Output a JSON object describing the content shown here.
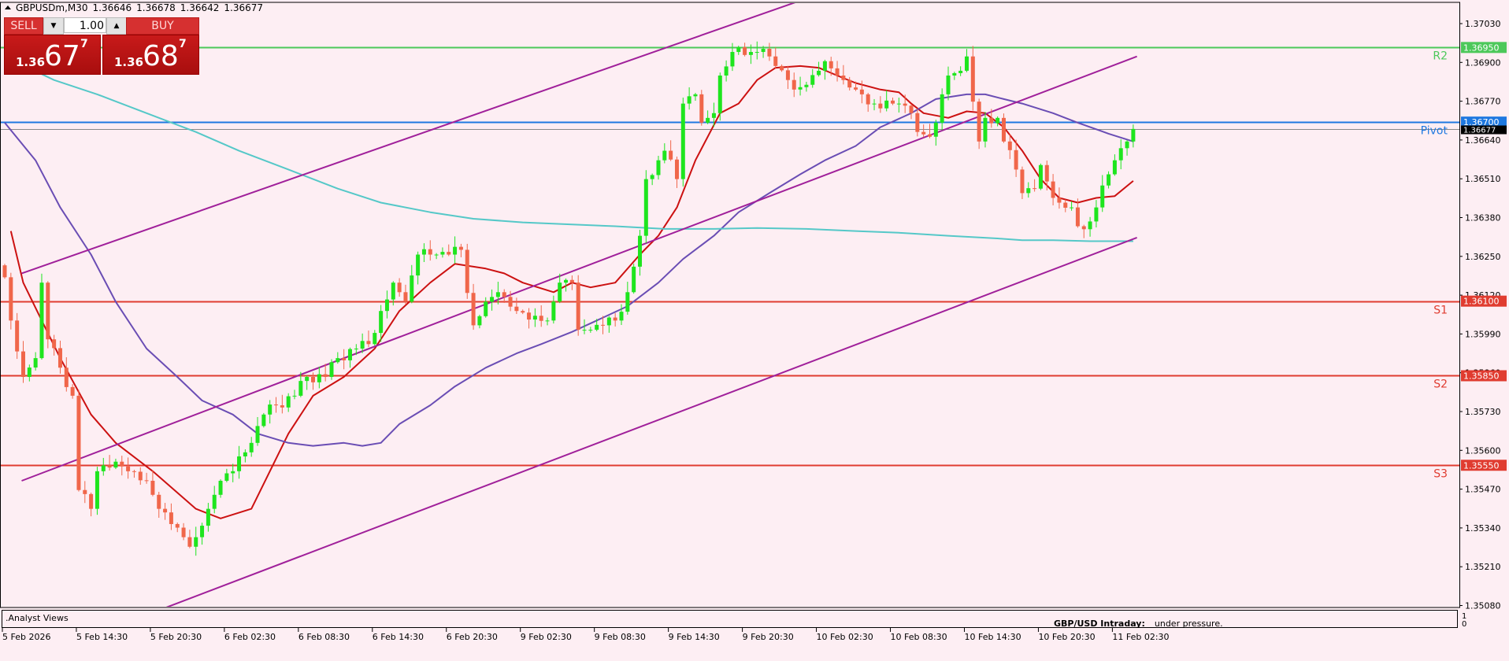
{
  "header": {
    "symbol": "GBPUSDm,M30",
    "open": "1.36646",
    "high": "1.36678",
    "low": "1.36642",
    "close": "1.36677"
  },
  "trade_panel": {
    "sell_label": "SELL",
    "buy_label": "BUY",
    "lot": "1.00",
    "sell_price": {
      "prefix": "1.36",
      "big": "67",
      "sup": "7"
    },
    "buy_price": {
      "prefix": "1.36",
      "big": "68",
      "sup": "7"
    }
  },
  "subwindow": {
    "name": ".Analyst Views",
    "headline": "GBP/USD Intraday:",
    "text": "under pressure.",
    "scale_top": "1",
    "scale_bottom": "0"
  },
  "colors": {
    "background": "#fdeef3",
    "bull": "#1ee51e",
    "bear": "#f0664a",
    "ma_fast": "#cc1111",
    "ma_mid": "#6a4db4",
    "ma_slow": "#55c8c8",
    "channel": "#a0209a",
    "r_level": "#4cc85a",
    "pivot": "#1e78e0",
    "s_level": "#e03c30"
  },
  "chart_data": {
    "type": "candlestick",
    "title": "GBPUSDm,M30",
    "ylim": [
      1.3502,
      1.3712
    ],
    "y_ticks": [
      "1.37030",
      "1.36900",
      "1.36770",
      "1.36640",
      "1.36510",
      "1.36380",
      "1.36250",
      "1.36120",
      "1.35990",
      "1.35860",
      "1.35730",
      "1.35600",
      "1.35470",
      "1.35340",
      "1.35210",
      "1.35080"
    ],
    "x_ticks": [
      {
        "bar": 0,
        "label": "5 Feb 2026"
      },
      {
        "bar": 12,
        "label": "5 Feb 14:30"
      },
      {
        "bar": 24,
        "label": "5 Feb 20:30"
      },
      {
        "bar": 36,
        "label": "6 Feb 02:30"
      },
      {
        "bar": 48,
        "label": "6 Feb 08:30"
      },
      {
        "bar": 60,
        "label": "6 Feb 14:30"
      },
      {
        "bar": 72,
        "label": "6 Feb 20:30"
      },
      {
        "bar": 84,
        "label": "9 Feb 02:30"
      },
      {
        "bar": 96,
        "label": "9 Feb 08:30"
      },
      {
        "bar": 108,
        "label": "9 Feb 14:30"
      },
      {
        "bar": 120,
        "label": "9 Feb 20:30"
      },
      {
        "bar": 132,
        "label": "10 Feb 02:30"
      },
      {
        "bar": 144,
        "label": "10 Feb 08:30"
      },
      {
        "bar": 156,
        "label": "10 Feb 14:30"
      },
      {
        "bar": 168,
        "label": "10 Feb 20:30"
      },
      {
        "bar": 180,
        "label": "11 Feb 02:30"
      }
    ],
    "bar_count": 184,
    "close_keypoints": [
      [
        0,
        1.3618
      ],
      [
        1,
        1.36035
      ],
      [
        3,
        1.35846
      ],
      [
        5,
        1.35909
      ],
      [
        6,
        1.36162
      ],
      [
        7,
        1.35972
      ],
      [
        9,
        1.35877
      ],
      [
        11,
        1.35783
      ],
      [
        12,
        1.35467
      ],
      [
        14,
        1.35404
      ],
      [
        15,
        1.3553
      ],
      [
        18,
        1.35562
      ],
      [
        20,
        1.3553
      ],
      [
        23,
        1.35498
      ],
      [
        25,
        1.35404
      ],
      [
        28,
        1.35341
      ],
      [
        30,
        1.35277
      ],
      [
        31,
        1.35309
      ],
      [
        33,
        1.35404
      ],
      [
        35,
        1.35498
      ],
      [
        37,
        1.3553
      ],
      [
        40,
        1.35625
      ],
      [
        42,
        1.3572
      ],
      [
        44,
        1.35751
      ],
      [
        47,
        1.35783
      ],
      [
        49,
        1.35846
      ],
      [
        52,
        1.35846
      ],
      [
        54,
        1.35909
      ],
      [
        57,
        1.35941
      ],
      [
        59,
        1.35956
      ],
      [
        61,
        1.36067
      ],
      [
        63,
        1.36162
      ],
      [
        65,
        1.36098
      ],
      [
        67,
        1.36256
      ],
      [
        70,
        1.36256
      ],
      [
        72,
        1.36256
      ],
      [
        74,
        1.36272
      ],
      [
        76,
        1.36019
      ],
      [
        78,
        1.36098
      ],
      [
        80,
        1.3613
      ],
      [
        81,
        1.36114
      ],
      [
        83,
        1.36067
      ],
      [
        86,
        1.36051
      ],
      [
        88,
        1.36035
      ],
      [
        90,
        1.36162
      ],
      [
        92,
        1.36162
      ],
      [
        93,
        1.36004
      ],
      [
        95,
        1.36004
      ],
      [
        97,
        1.36019
      ],
      [
        99,
        1.36035
      ],
      [
        101,
        1.3613
      ],
      [
        103,
        1.36319
      ],
      [
        104,
        1.36509
      ],
      [
        106,
        1.36572
      ],
      [
        107,
        1.36604
      ],
      [
        109,
        1.36509
      ],
      [
        110,
        1.36762
      ],
      [
        112,
        1.36793
      ],
      [
        113,
        1.36698
      ],
      [
        115,
        1.3673
      ],
      [
        116,
        1.36856
      ],
      [
        118,
        1.36935
      ],
      [
        119,
        1.36951
      ],
      [
        121,
        1.36935
      ],
      [
        122,
        1.36935
      ],
      [
        124,
        1.3692
      ],
      [
        125,
        1.36888
      ],
      [
        127,
        1.36841
      ],
      [
        128,
        1.36809
      ],
      [
        130,
        1.36825
      ],
      [
        132,
        1.36872
      ],
      [
        133,
        1.36904
      ],
      [
        135,
        1.36856
      ],
      [
        136,
        1.36841
      ],
      [
        138,
        1.36809
      ],
      [
        139,
        1.36793
      ],
      [
        141,
        1.36762
      ],
      [
        142,
        1.36746
      ],
      [
        144,
        1.36762
      ],
      [
        145,
        1.36762
      ],
      [
        147,
        1.3673
      ],
      [
        148,
        1.36667
      ],
      [
        150,
        1.36651
      ],
      [
        151,
        1.36698
      ],
      [
        152,
        1.36793
      ],
      [
        153,
        1.36856
      ],
      [
        155,
        1.36872
      ],
      [
        156,
        1.3692
      ],
      [
        158,
        1.36635
      ],
      [
        159,
        1.36714
      ],
      [
        161,
        1.36714
      ],
      [
        162,
        1.36635
      ],
      [
        164,
        1.36541
      ],
      [
        165,
        1.36462
      ],
      [
        167,
        1.36477
      ],
      [
        168,
        1.36556
      ],
      [
        170,
        1.36446
      ],
      [
        171,
        1.3643
      ],
      [
        173,
        1.36414
      ],
      [
        174,
        1.36351
      ],
      [
        176,
        1.36367
      ],
      [
        177,
        1.36414
      ],
      [
        179,
        1.36525
      ],
      [
        180,
        1.36572
      ],
      [
        182,
        1.36635
      ],
      [
        183,
        1.36677
      ]
    ],
    "indicators": [
      {
        "name": "ma-fast",
        "color_key": "ma_fast",
        "points": [
          [
            1,
            1.36335
          ],
          [
            3,
            1.36162
          ],
          [
            6,
            1.36035
          ],
          [
            9,
            1.35909
          ],
          [
            14,
            1.3572
          ],
          [
            18,
            1.35625
          ],
          [
            24,
            1.3553
          ],
          [
            31,
            1.35404
          ],
          [
            35,
            1.35372
          ],
          [
            40,
            1.35404
          ],
          [
            43,
            1.3553
          ],
          [
            46,
            1.35656
          ],
          [
            50,
            1.35783
          ],
          [
            55,
            1.35846
          ],
          [
            60,
            1.35941
          ],
          [
            64,
            1.36067
          ],
          [
            69,
            1.36162
          ],
          [
            73,
            1.36225
          ],
          [
            78,
            1.36209
          ],
          [
            81,
            1.36193
          ],
          [
            84,
            1.36162
          ],
          [
            89,
            1.3613
          ],
          [
            92,
            1.36162
          ],
          [
            95,
            1.36146
          ],
          [
            99,
            1.36162
          ],
          [
            103,
            1.36256
          ],
          [
            106,
            1.36319
          ],
          [
            109,
            1.36414
          ],
          [
            112,
            1.36572
          ],
          [
            116,
            1.3673
          ],
          [
            119,
            1.36762
          ],
          [
            122,
            1.36841
          ],
          [
            125,
            1.36882
          ],
          [
            129,
            1.36888
          ],
          [
            132,
            1.36882
          ],
          [
            135,
            1.36856
          ],
          [
            138,
            1.36831
          ],
          [
            142,
            1.36809
          ],
          [
            145,
            1.368
          ],
          [
            147,
            1.36762
          ],
          [
            149,
            1.3673
          ],
          [
            153,
            1.36714
          ],
          [
            156,
            1.36736
          ],
          [
            159,
            1.3673
          ],
          [
            162,
            1.36683
          ],
          [
            165,
            1.36604
          ],
          [
            168,
            1.36509
          ],
          [
            171,
            1.36446
          ],
          [
            174,
            1.3643
          ],
          [
            177,
            1.36446
          ],
          [
            180,
            1.36452
          ],
          [
            183,
            1.36503
          ]
        ]
      },
      {
        "name": "ma-mid",
        "color_key": "ma_mid",
        "points": [
          [
            0,
            1.36698
          ],
          [
            5,
            1.36572
          ],
          [
            9,
            1.36414
          ],
          [
            14,
            1.36256
          ],
          [
            18,
            1.36098
          ],
          [
            23,
            1.35941
          ],
          [
            28,
            1.35846
          ],
          [
            32,
            1.35767
          ],
          [
            37,
            1.3572
          ],
          [
            41,
            1.35656
          ],
          [
            46,
            1.35625
          ],
          [
            50,
            1.35615
          ],
          [
            55,
            1.35625
          ],
          [
            58,
            1.35615
          ],
          [
            61,
            1.35625
          ],
          [
            64,
            1.35688
          ],
          [
            69,
            1.35751
          ],
          [
            73,
            1.35814
          ],
          [
            78,
            1.35877
          ],
          [
            83,
            1.35925
          ],
          [
            87,
            1.35956
          ],
          [
            92,
            1.35997
          ],
          [
            96,
            1.36035
          ],
          [
            101,
            1.36083
          ],
          [
            106,
            1.36162
          ],
          [
            110,
            1.36241
          ],
          [
            115,
            1.36319
          ],
          [
            119,
            1.36398
          ],
          [
            124,
            1.36462
          ],
          [
            129,
            1.36525
          ],
          [
            133,
            1.36572
          ],
          [
            138,
            1.3662
          ],
          [
            142,
            1.36683
          ],
          [
            147,
            1.3673
          ],
          [
            151,
            1.36777
          ],
          [
            156,
            1.36793
          ],
          [
            159,
            1.36793
          ],
          [
            162,
            1.36777
          ],
          [
            165,
            1.36762
          ],
          [
            170,
            1.3673
          ],
          [
            174,
            1.36698
          ],
          [
            179,
            1.36661
          ],
          [
            183,
            1.36635
          ]
        ]
      },
      {
        "name": "ma-slow",
        "color_key": "ma_slow",
        "points": [
          [
            0,
            1.3692
          ],
          [
            8,
            1.36841
          ],
          [
            15,
            1.36793
          ],
          [
            23,
            1.3673
          ],
          [
            31,
            1.36667
          ],
          [
            38,
            1.36604
          ],
          [
            46,
            1.36541
          ],
          [
            54,
            1.36477
          ],
          [
            61,
            1.3643
          ],
          [
            69,
            1.36398
          ],
          [
            76,
            1.36376
          ],
          [
            84,
            1.36364
          ],
          [
            92,
            1.36357
          ],
          [
            99,
            1.36351
          ],
          [
            107,
            1.36342
          ],
          [
            115,
            1.36342
          ],
          [
            122,
            1.36345
          ],
          [
            130,
            1.36342
          ],
          [
            138,
            1.36335
          ],
          [
            145,
            1.36329
          ],
          [
            153,
            1.36319
          ],
          [
            161,
            1.3631
          ],
          [
            165,
            1.36304
          ],
          [
            170,
            1.36304
          ],
          [
            176,
            1.36301
          ],
          [
            183,
            1.36301
          ]
        ]
      },
      {
        "name": "channel-upper",
        "color_key": "channel",
        "points": [
          [
            2.75,
            1.36193
          ],
          [
            129.3,
            1.37109
          ]
        ]
      },
      {
        "name": "channel-middle",
        "color_key": "channel",
        "points": [
          [
            2.75,
            1.35498
          ],
          [
            183.6,
            1.3692
          ]
        ]
      },
      {
        "name": "channel-lower",
        "color_key": "channel",
        "points": [
          [
            26,
            1.35072
          ],
          [
            183.6,
            1.36313
          ]
        ]
      }
    ],
    "levels": [
      {
        "label": "R2",
        "value": "1.36950",
        "color_key": "r_level"
      },
      {
        "label": "Pivot",
        "value": "1.36700",
        "color_key": "pivot"
      },
      {
        "label": "S1",
        "value": "1.36100",
        "color_key": "s_level"
      },
      {
        "label": "S2",
        "value": "1.35850",
        "color_key": "s_level"
      },
      {
        "label": "S3",
        "value": "1.35550",
        "color_key": "s_level"
      }
    ],
    "current_price": "1.36677"
  }
}
